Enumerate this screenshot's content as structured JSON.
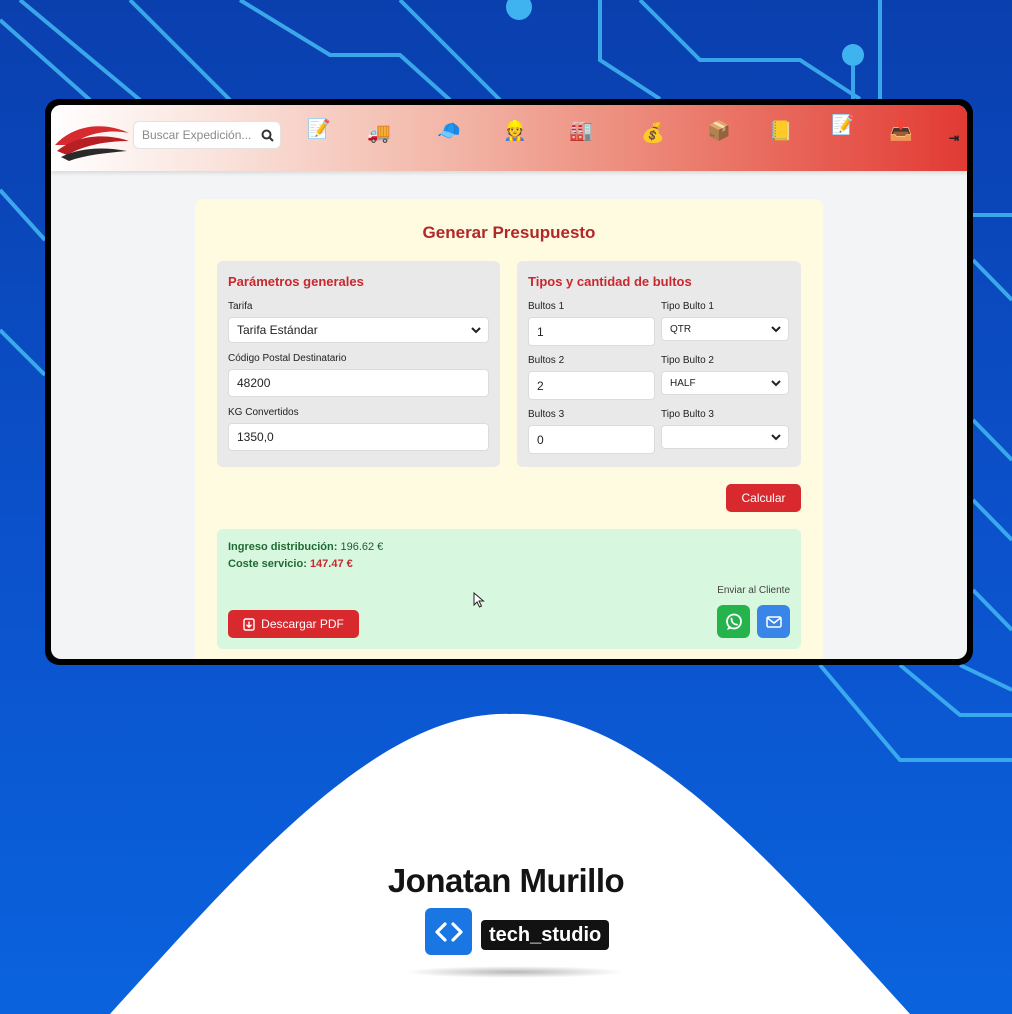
{
  "navbar": {
    "search_placeholder": "Buscar Expedición...",
    "icons": [
      "edit-icon",
      "truck-icon",
      "cap-icon",
      "workers-icon",
      "factory-icon",
      "money-bag-icon",
      "package-icon",
      "folder-icon",
      "document-icon",
      "inbox-icon"
    ],
    "logout_glyph": "⇥"
  },
  "card": {
    "title": "Generar Presupuesto",
    "general": {
      "title": "Parámetros generales",
      "tarifa_label": "Tarifa",
      "tarifa_value": "Tarifa Estándar",
      "cp_label": "Código Postal Destinatario",
      "cp_value": "48200",
      "kg_label": "KG Convertidos",
      "kg_value": "1350,0"
    },
    "bultos": {
      "title": "Tipos y cantidad de bultos",
      "rows": [
        {
          "qty_label": "Bultos 1",
          "qty_value": "1",
          "type_label": "Tipo Bulto 1",
          "type_value": "QTR"
        },
        {
          "qty_label": "Bultos 2",
          "qty_value": "2",
          "type_label": "Tipo Bulto 2",
          "type_value": "HALF"
        },
        {
          "qty_label": "Bultos 3",
          "qty_value": "0",
          "type_label": "Tipo Bulto 3",
          "type_value": ""
        }
      ]
    },
    "calc_label": "Calcular",
    "result": {
      "ingreso_label": "Ingreso distribución:",
      "ingreso_value": "196.62 €",
      "coste_label": "Coste servicio:",
      "coste_value": "147.47 €",
      "pdf_label": "Descargar PDF",
      "send_label": "Enviar al Cliente"
    }
  },
  "brand": {
    "name": "Jonatan Murillo",
    "tag": "tech_studio"
  },
  "colors": {
    "accent_red": "#d82a2e",
    "title_red": "#b3262a",
    "card_bg": "#fefbe0",
    "result_bg": "#d8f7df",
    "whatsapp": "#25b34b",
    "mail": "#3a86e8",
    "background_blue": "#0b52cc"
  }
}
